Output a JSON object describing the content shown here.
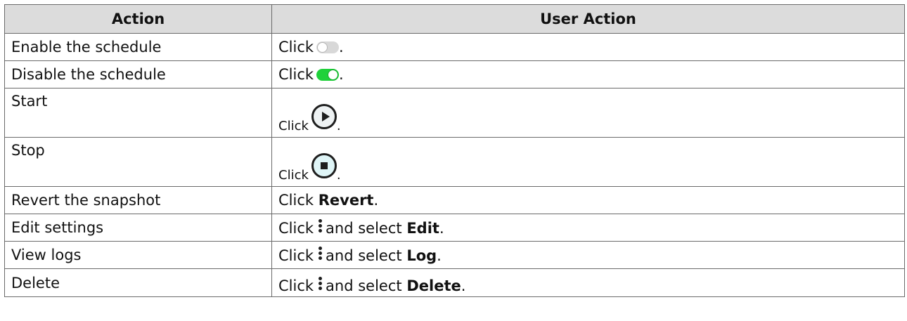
{
  "table": {
    "headers": [
      "Action",
      "User Action"
    ],
    "rows": [
      {
        "action": "Enable the schedule",
        "click": "Click",
        "icon": "toggle-off-icon",
        "suffix": "."
      },
      {
        "action": "Disable the schedule",
        "click": "Click",
        "icon": "toggle-on-icon",
        "suffix": "."
      },
      {
        "action": "Start",
        "click": "Click",
        "icon": "play-icon",
        "suffix": "."
      },
      {
        "action": "Stop",
        "click": "Click",
        "icon": "stop-icon",
        "suffix": "."
      },
      {
        "action": "Revert the snapshot",
        "click": "Click",
        "target": "Revert",
        "suffix": "."
      },
      {
        "action": "Edit settings",
        "click": "Click",
        "icon": "more-vertical-icon",
        "middle": "and select",
        "target": "Edit",
        "suffix": "."
      },
      {
        "action": "View logs",
        "click": "Click",
        "icon": "more-vertical-icon",
        "middle": "and select",
        "target": "Log",
        "suffix": "."
      },
      {
        "action": "Delete",
        "click": "Click",
        "icon": "more-vertical-icon",
        "middle": "and select",
        "target": "Delete",
        "suffix": "."
      }
    ]
  },
  "colors": {
    "header_background": "#dcdcdc",
    "toggle_on": "#1fd13a",
    "toggle_off": "#d8d8d8"
  }
}
